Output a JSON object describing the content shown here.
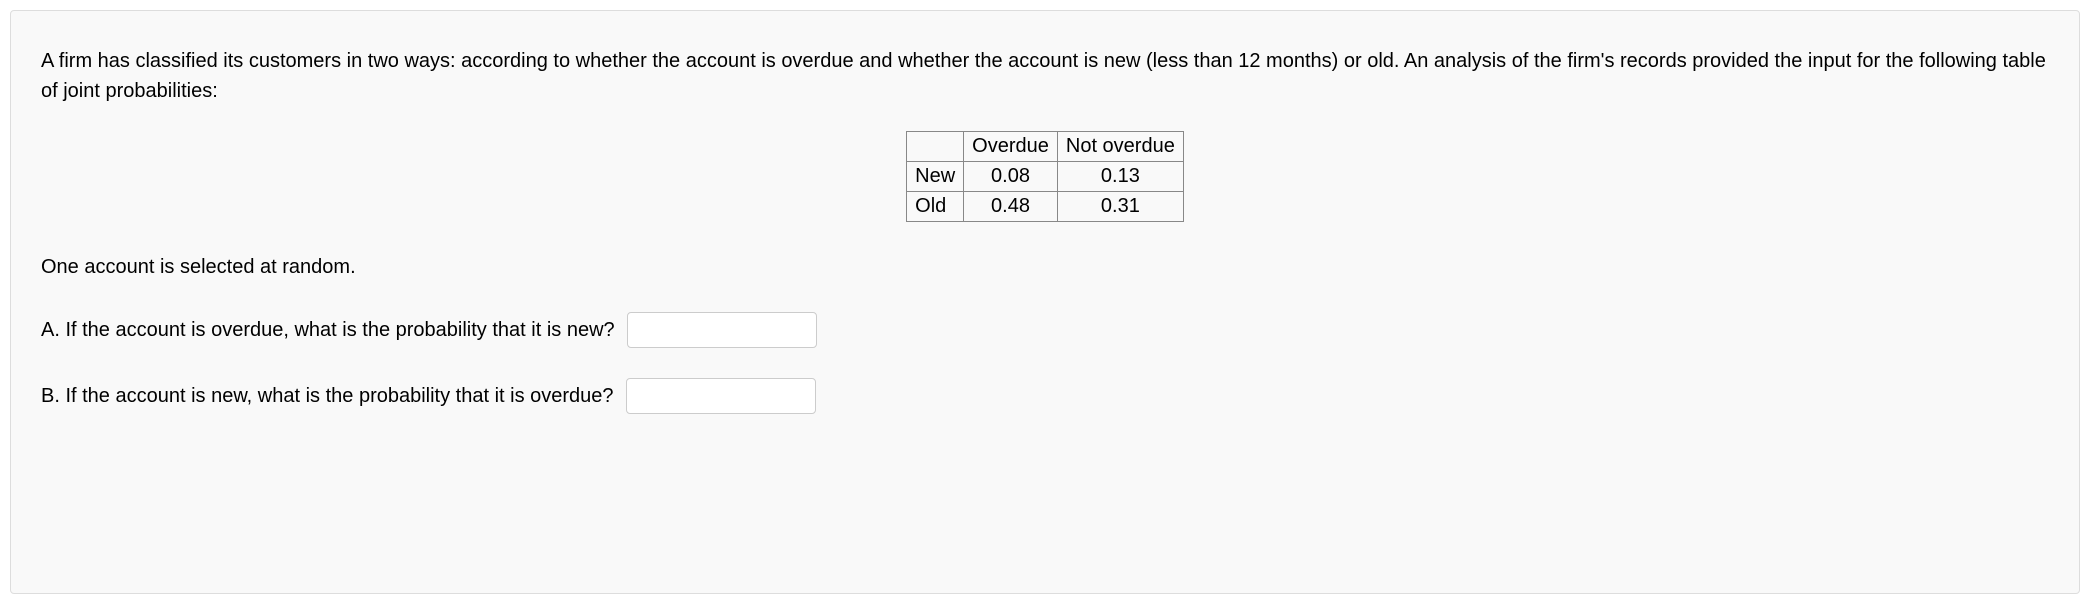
{
  "intro": "A firm has classified its customers in two ways: according to whether the account is overdue and whether the account is new (less than 12 months) or old. An analysis of the firm's records provided the input for the following table of joint probabilities:",
  "table": {
    "headers": {
      "blank": "",
      "col1": "Overdue",
      "col2": "Not overdue"
    },
    "rows": [
      {
        "label": "New",
        "overdue": "0.08",
        "not_overdue": "0.13"
      },
      {
        "label": "Old",
        "overdue": "0.48",
        "not_overdue": "0.31"
      }
    ]
  },
  "subtext": "One account is selected at random.",
  "questions": {
    "a": "A. If the account is overdue, what is the probability that it is new?",
    "b": "B. If the account is new, what is the probability that it is overdue?"
  },
  "inputs": {
    "a_value": "",
    "b_value": ""
  }
}
